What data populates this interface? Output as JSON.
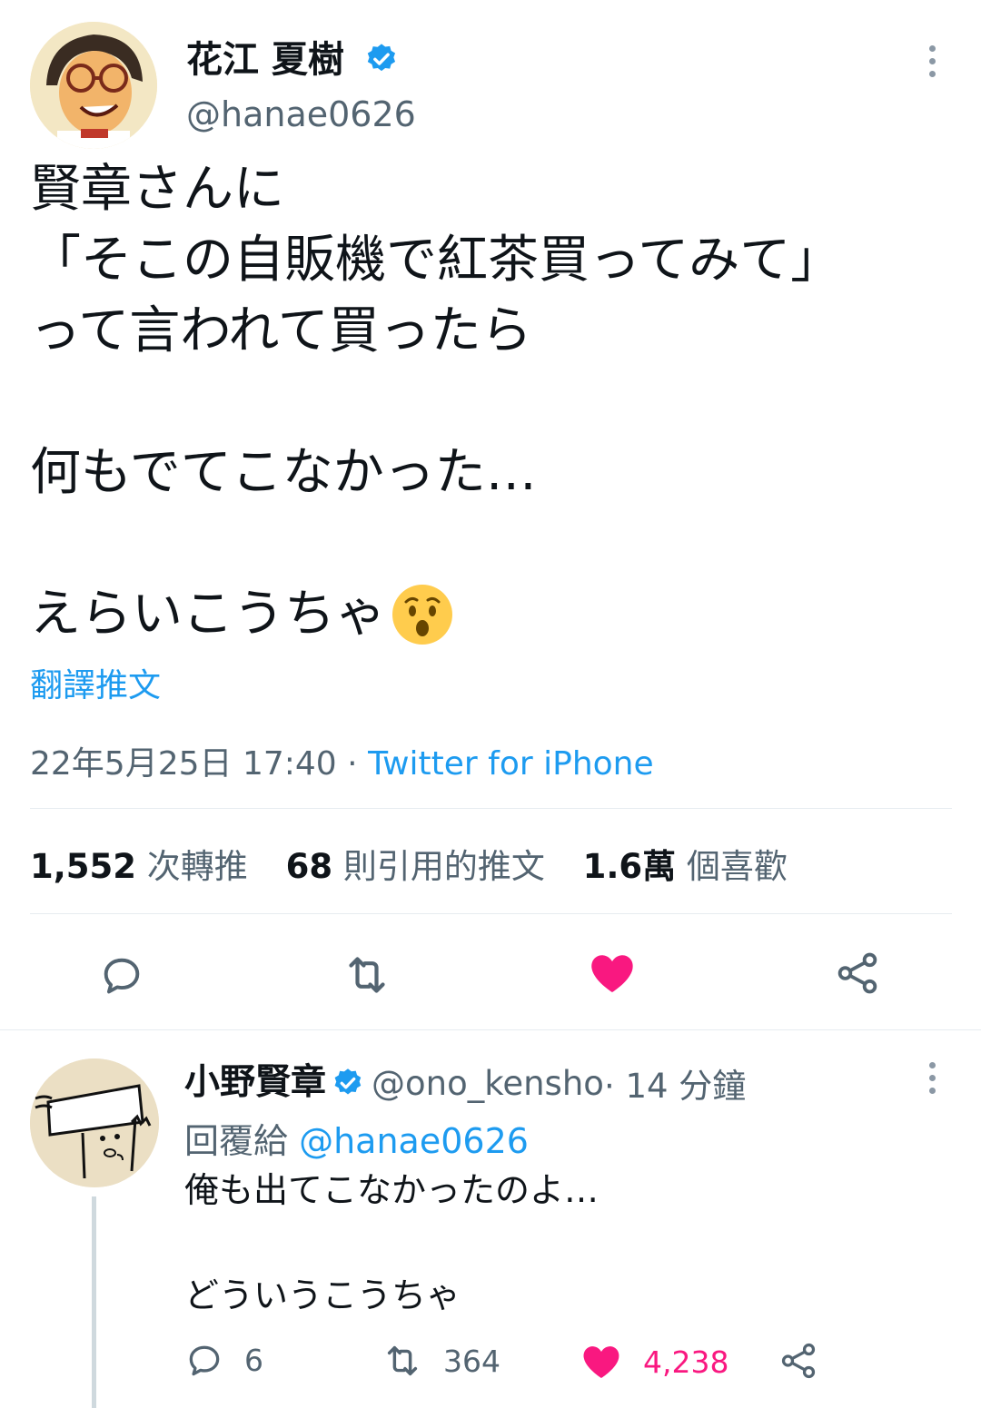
{
  "main_tweet": {
    "author_name": "花江 夏樹",
    "author_handle": "@hanae0626",
    "text_lines": [
      "賢章さんに",
      "「そこの自販機で紅茶買ってみて」",
      "って言われて買ったら",
      "",
      "何もでてこなかった…",
      "",
      "えらいこうちゃ"
    ],
    "emoji": "😯",
    "translate_label": "翻譯推文",
    "timestamp": "22年5月25日 17:40",
    "separator": " · ",
    "source": "Twitter for iPhone",
    "stats": {
      "retweets_count": "1,552",
      "retweets_label": " 次轉推",
      "quotes_count": "68",
      "quotes_label": " 則引用的推文",
      "likes_count": "1.6萬",
      "likes_label": " 個喜歡"
    },
    "icons": {
      "reply": "reply-icon",
      "retweet": "retweet-icon",
      "like": "heart-icon",
      "share": "share-icon"
    },
    "liked": true
  },
  "reply_tweet": {
    "author_name": "小野賢章",
    "author_handle": "@ono_kensho",
    "time": " · 14 分鐘",
    "replying_to_label": "回覆給 ",
    "replying_to_handle": "@hanae0626",
    "text_lines": [
      "俺も出てこなかったのよ…",
      "",
      "どういうこうちゃ"
    ],
    "reply_count": "6",
    "retweet_count": "364",
    "like_count": "4,238"
  },
  "colors": {
    "accent": "#1d9bf0",
    "like": "#f91880",
    "secondary_text": "#536471"
  }
}
